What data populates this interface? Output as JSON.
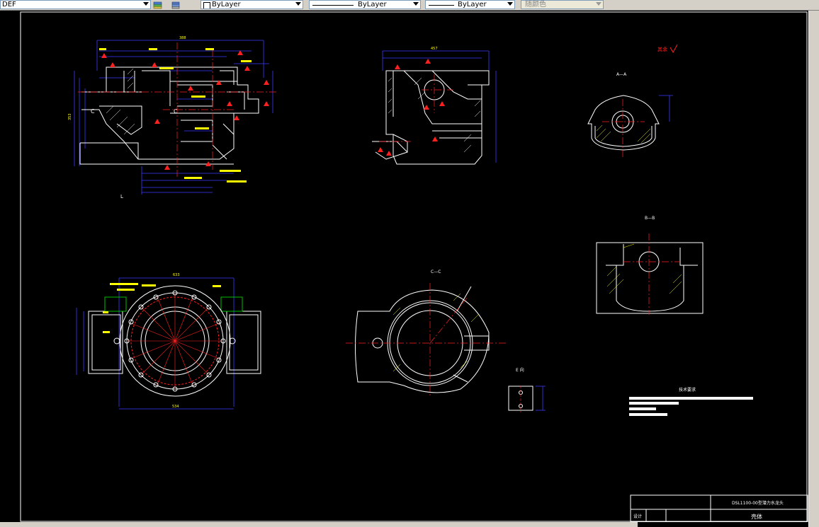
{
  "toolbar": {
    "layer_name": "DEF",
    "color_value": "ByLayer",
    "linetype_value": "ByLayer",
    "lineweight_value": "ByLayer",
    "plotstyle_value": "随颜色"
  },
  "drawing": {
    "section_a": "A—A",
    "section_b": "B—B",
    "section_c": "C—C",
    "view_e": "E 向",
    "label_l": "L",
    "cut_c_left": "C",
    "cut_c_mid": "C",
    "remaining_mark": "其余",
    "tech_requirements_title": "技术要求",
    "dim_top_overall": "388",
    "dim_top_view2": "457",
    "dim_bottom_plan": "534",
    "dim_top_plan": "633",
    "dim_height": "353",
    "title_block": {
      "drawing_number": "DSL1100-00型潜力水龙头",
      "part_name": "壳体",
      "designer_label": "设计"
    }
  },
  "colors": {
    "outline": "#ffffff",
    "dimension": "#3a3aff",
    "centerline": "#ff2020",
    "hatch": "#ffff00",
    "accent_green": "#00c000"
  }
}
